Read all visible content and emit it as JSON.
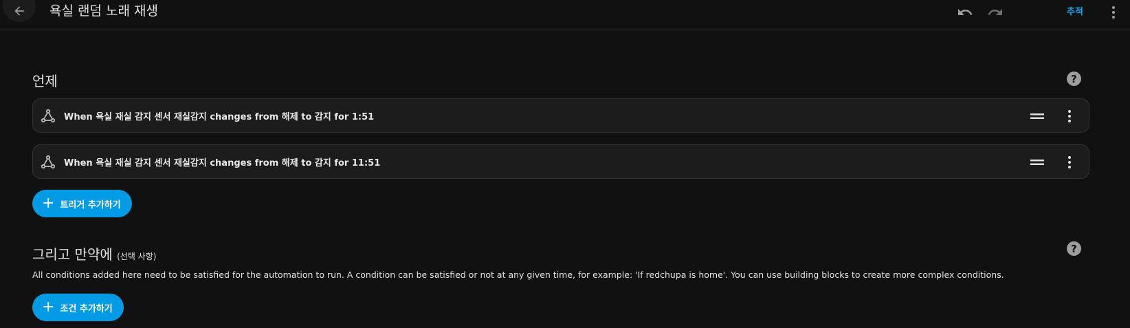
{
  "header": {
    "title": "욕실 랜덤 노래 재생",
    "track_label": "추적",
    "icons": [
      "arrow-left-icon",
      "undo-icon",
      "redo-icon",
      "more-vertical-icon"
    ]
  },
  "triggers": {
    "title": "언제",
    "items": [
      {
        "label": "When 욕실 재실 감지 센서 재실감지 changes from 해제 to 감지 for 1:51",
        "icon": "trigger-graph-icon"
      },
      {
        "label": "When 욕실 재실 감지 센서 재실감지 changes from 해제 to 감지 for 11:51",
        "icon": "trigger-graph-icon"
      }
    ],
    "add_label": "트리거 추가하기"
  },
  "conditions": {
    "title": "그리고 만약에",
    "subtitle": "(선택 사항)",
    "description": "All conditions added here need to be satisfied for the automation to run. A condition can be satisfied or not at any given time, for example: 'If redchupa is home'. You can use building blocks to create more complex conditions.",
    "add_label": "조건 추가하기"
  },
  "colors": {
    "background": "#111111",
    "card": "#1c1c1c",
    "accent": "#039be5",
    "link": "#03a9f4"
  }
}
